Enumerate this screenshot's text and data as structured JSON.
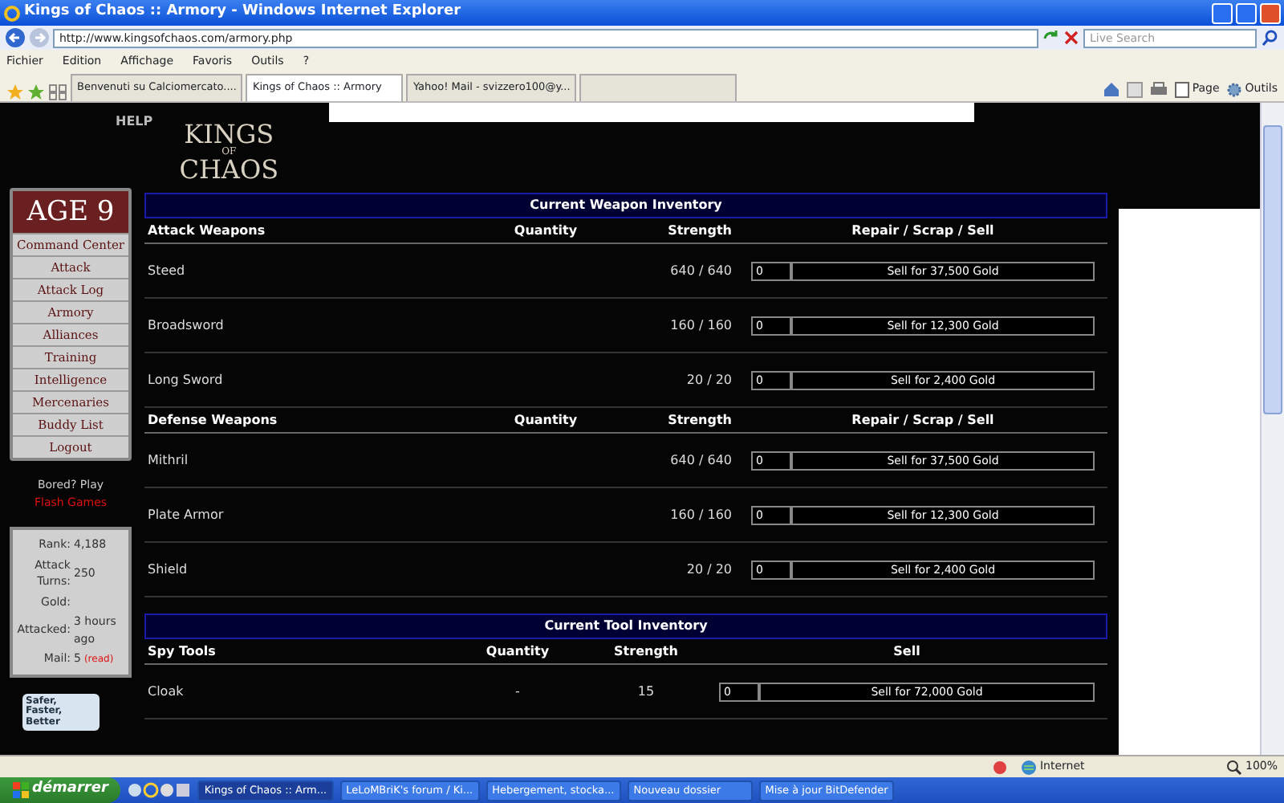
{
  "window": {
    "title": "Kings of Chaos :: Armory - Windows Internet Explorer"
  },
  "address_bar": {
    "url": "http://www.kingsofchaos.com/armory.php"
  },
  "search": {
    "placeholder": "Live Search"
  },
  "menu": [
    "Fichier",
    "Edition",
    "Affichage",
    "Favoris",
    "Outils",
    "?"
  ],
  "tabs": [
    {
      "label": "Benvenuti su Calciomercato....",
      "selected": false
    },
    {
      "label": "Kings of Chaos :: Armory",
      "selected": true
    },
    {
      "label": "Yahoo! Mail - svizzero100@y...",
      "selected": false
    }
  ],
  "command_bar": [
    "Page",
    "Outils"
  ],
  "site": {
    "help": "HELP",
    "logo": {
      "top": "KINGS",
      "middle": "OF",
      "bottom": "CHAOS"
    },
    "age_badge": "AGE 9",
    "nav": [
      "Command Center",
      "Attack",
      "Attack Log",
      "Armory",
      "Alliances",
      "Training",
      "Intelligence",
      "Mercenaries",
      "Buddy List",
      "Logout"
    ],
    "promo": {
      "text": "Bored? Play",
      "link": "Flash Games"
    },
    "stats": [
      {
        "label": "Rank:",
        "value": "4,188"
      },
      {
        "label": "Attack Turns:",
        "value": "250"
      },
      {
        "label": "Gold:"
      },
      {
        "label": "Attacked:",
        "value": "3 hours ago"
      },
      {
        "label": "Mail:",
        "value": "5",
        "note": "(read)"
      }
    ],
    "banner": "Safer, Faster, Better"
  },
  "weapon_inventory": {
    "title": "Current Weapon Inventory",
    "sections": [
      {
        "columns": [
          "Attack Weapons",
          "Quantity",
          "Strength",
          "Repair / Scrap / Sell"
        ],
        "rows": [
          {
            "name": "Steed",
            "strength": "640 / 640",
            "amount": "0",
            "sell": "Sell for 37,500 Gold"
          },
          {
            "name": "Broadsword",
            "strength": "160 / 160",
            "amount": "0",
            "sell": "Sell for 12,300 Gold"
          },
          {
            "name": "Long Sword",
            "strength": "20 / 20",
            "amount": "0",
            "sell": "Sell for 2,400 Gold"
          }
        ]
      },
      {
        "columns": [
          "Defense Weapons",
          "Quantity",
          "Strength",
          "Repair / Scrap / Sell"
        ],
        "rows": [
          {
            "name": "Mithril",
            "strength": "640 / 640",
            "amount": "0",
            "sell": "Sell for 37,500 Gold"
          },
          {
            "name": "Plate Armor",
            "strength": "160 / 160",
            "amount": "0",
            "sell": "Sell for 12,300 Gold"
          },
          {
            "name": "Shield",
            "strength": "20 / 20",
            "amount": "0",
            "sell": "Sell for 2,400 Gold"
          }
        ]
      }
    ]
  },
  "tool_inventory": {
    "title": "Current Tool Inventory",
    "columns": [
      "Spy Tools",
      "Quantity",
      "Strength",
      "Sell"
    ],
    "rows": [
      {
        "name": "Cloak",
        "quantity": "-",
        "strength": "15",
        "amount": "0",
        "sell": "Sell for 72,000 Gold"
      }
    ]
  },
  "status_bar": {
    "zone": "Internet",
    "zoom": "100%"
  },
  "taskbar": {
    "start": "démarrer",
    "items": [
      {
        "label": "Kings of Chaos :: Arm...",
        "selected": true
      },
      {
        "label": "LeLoMBriK's forum / Ki...",
        "selected": false
      },
      {
        "label": "Hebergement, stocka...",
        "selected": false
      },
      {
        "label": "Nouveau dossier",
        "selected": false
      },
      {
        "label": "Mise à jour BitDefender",
        "selected": false
      }
    ]
  }
}
